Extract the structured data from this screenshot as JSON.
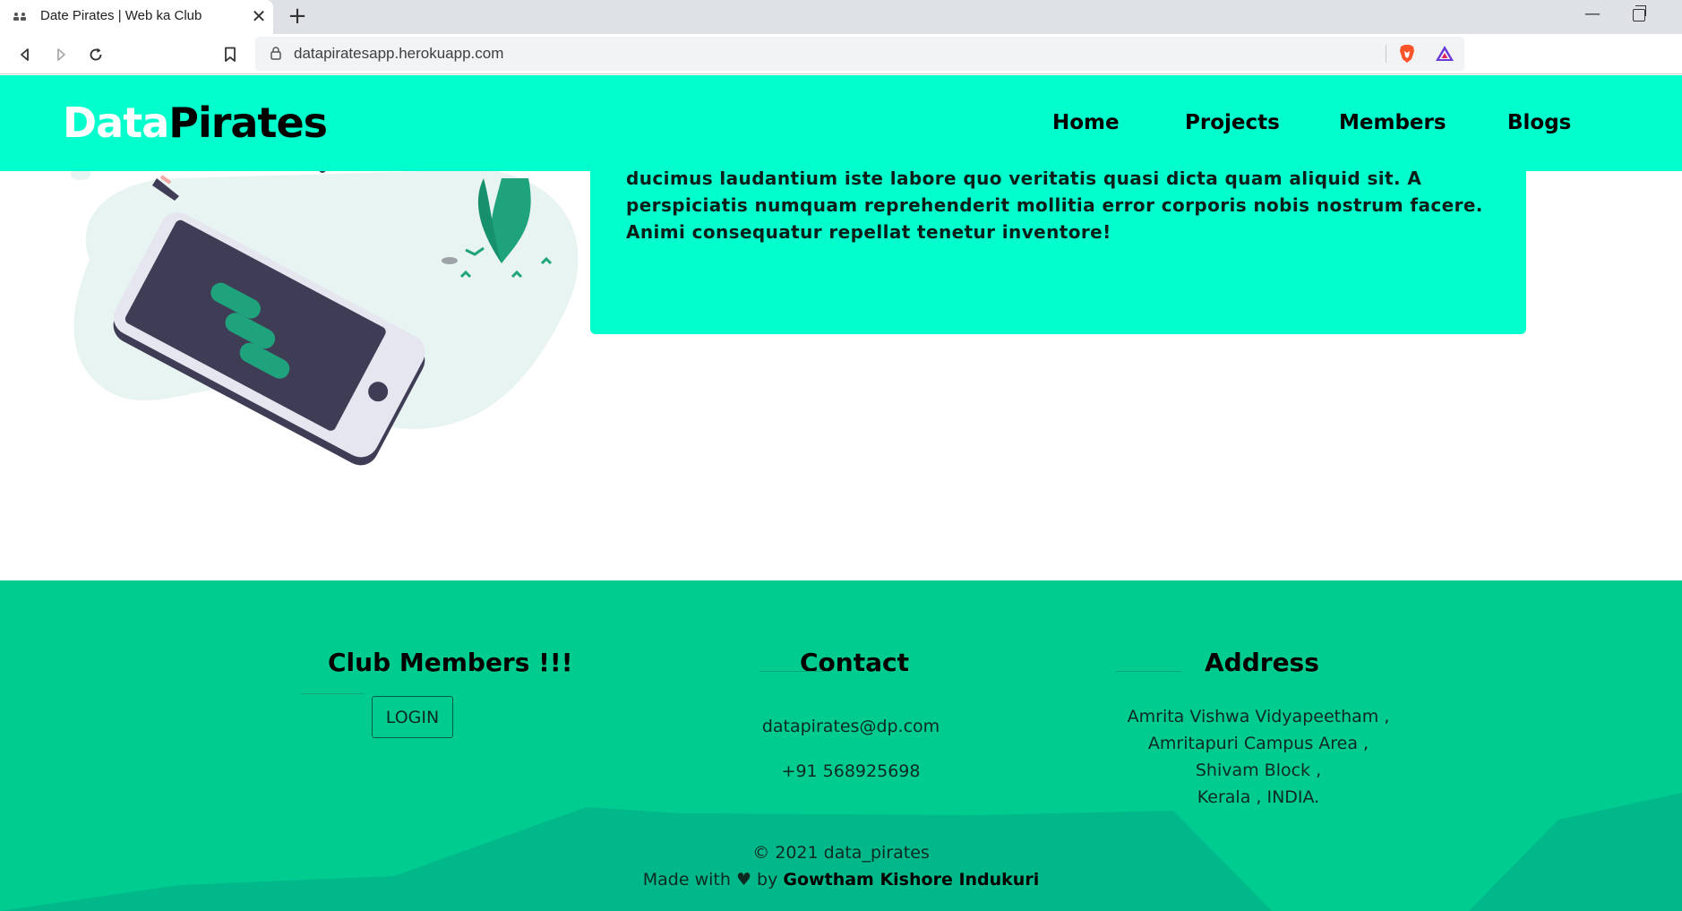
{
  "browser": {
    "tab_title": "Date Pirates | Web ka Club",
    "address": "datapiratesapp.herokuapp.com"
  },
  "navbar": {
    "brand_part1": "Data",
    "brand_part2": "Pirates",
    "links": [
      "Home",
      "Projects",
      "Members",
      "Blogs"
    ]
  },
  "hero": {
    "card_text": "ducimus laudantium iste labore quo veritatis quasi dicta quam aliquid sit. A perspiciatis numquam reprehenderit mollitia error corporis nobis nostrum facere. Animi consequatur repellat tenetur inventore!"
  },
  "footer": {
    "members_heading": "Club Members !!!",
    "login_label": "LOGIN",
    "contact_heading": "Contact",
    "email": "datapirates@dp.com",
    "phone": "+91 568925698",
    "address_heading": "Address",
    "address_lines": [
      "Amrita Vishwa Vidyapeetham ,",
      "Amritapuri Campus Area ,",
      "Shivam Block ,",
      "Kerala , INDIA."
    ],
    "copyright": "© 2021 data_pirates",
    "made_with": "Made with",
    "heart": "♥",
    "by": "by",
    "author": "Gowtham Kishore Indukuri"
  },
  "colors": {
    "accent": "#00ffcc",
    "footer_bg": "#00cc8f",
    "footer_mountain": "#00b88a",
    "illustration_phone": "#3f3d56",
    "illustration_green": "#1fa37c"
  },
  "icons": [
    "back-icon",
    "forward-icon",
    "reload-icon",
    "bookmark-icon",
    "lock-icon",
    "brave-shield-icon",
    "brave-rewards-icon",
    "tab-close-icon",
    "new-tab-icon",
    "minimize-icon",
    "restore-icon"
  ]
}
